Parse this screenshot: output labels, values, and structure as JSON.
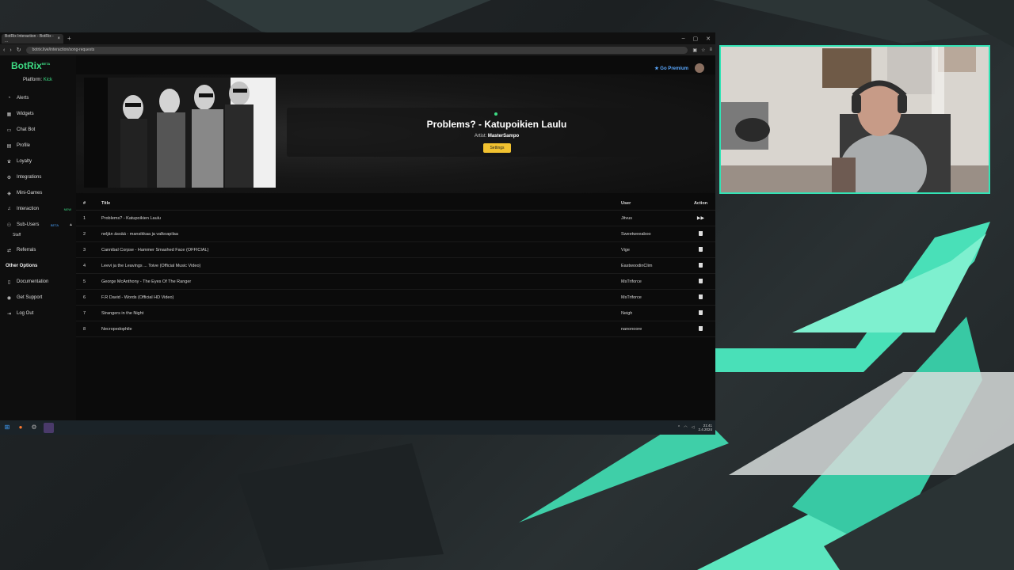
{
  "browser": {
    "tab_title": "BotRix Interaction - BotRix - ...",
    "tab_close": "×",
    "new_tab": "+",
    "url": "botrix.live/interaction/song-requests",
    "window_controls": [
      "–",
      "▢",
      "✕"
    ]
  },
  "app": {
    "logo": "BotRix",
    "logo_badge": "BETA",
    "platform_label": "Platform:",
    "platform_value": "Kick",
    "go_premium": "★ Go Premium"
  },
  "sidebar": {
    "items": [
      {
        "label": "Alerts",
        "icon": "bell-icon"
      },
      {
        "label": "Widgets",
        "icon": "widget-icon"
      },
      {
        "label": "Chat Bot",
        "icon": "chat-icon"
      },
      {
        "label": "Profile",
        "icon": "profile-icon"
      },
      {
        "label": "Loyalty",
        "icon": "trophy-icon"
      },
      {
        "label": "Integrations",
        "icon": "plug-icon"
      },
      {
        "label": "Mini-Games",
        "icon": "gamepad-icon"
      },
      {
        "label": "Interaction",
        "icon": "music-icon",
        "badge": "NEW"
      },
      {
        "label": "Sub-Users",
        "icon": "users-icon",
        "badge": "BETA"
      }
    ],
    "sub_item": "Staff",
    "referrals": "Referrals",
    "other_options_title": "Other Options",
    "other_items": [
      {
        "label": "Documentation",
        "icon": "doc-icon"
      },
      {
        "label": "Get Support",
        "icon": "support-icon"
      },
      {
        "label": "Log Out",
        "icon": "logout-icon"
      }
    ]
  },
  "now_playing": {
    "title": "Problems? - Katupoikien Laulu",
    "artist_label": "Artist:",
    "artist": "MasterSampo",
    "settings_button": "Settings"
  },
  "table": {
    "headers": {
      "num": "#",
      "title": "Title",
      "user": "User",
      "action": "Action"
    },
    "rows": [
      {
        "num": "1",
        "title": "Problems? - Katupoikien Laulu",
        "user": "Jitvus"
      },
      {
        "num": "2",
        "title": "neljän ässää - mansikkaa ja valkoapilaa",
        "user": "Sweetweeaboo"
      },
      {
        "num": "3",
        "title": "Cannibal Corpse - Hammer Smashed Face (OFFICIAL)",
        "user": "Vige"
      },
      {
        "num": "4",
        "title": "Leevi ja the Leavings ... Toive (Official Music Video)",
        "user": "EastwoodinClim"
      },
      {
        "num": "5",
        "title": "George McAnthony - The Eyes Of The Ranger",
        "user": "MsTriforce"
      },
      {
        "num": "6",
        "title": "F.R David - Words (Official HD Video)",
        "user": "MsTriforce"
      },
      {
        "num": "7",
        "title": "Strangers in the Night",
        "user": "Neigh"
      },
      {
        "num": "8",
        "title": "Necropedophile",
        "user": "nanonoore"
      }
    ]
  },
  "taskbar": {
    "time": "21:41",
    "date": "2.4.2024"
  },
  "colors": {
    "accent_green": "#3ddc84",
    "premium_blue": "#5aa8ff",
    "settings_yellow": "#f2c230",
    "webcam_border": "#33e3b5"
  }
}
